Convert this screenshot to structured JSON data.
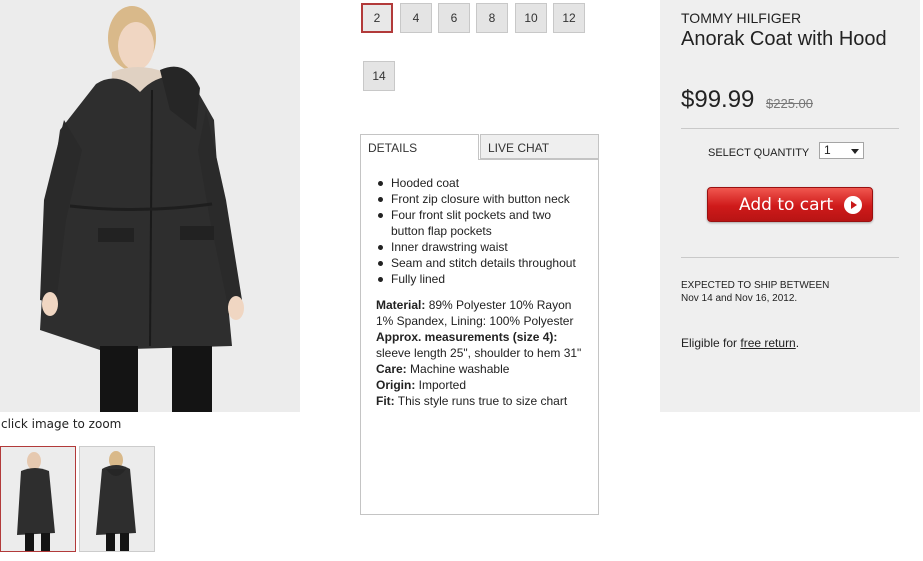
{
  "product": {
    "brand": "TOMMY HILFIGER",
    "name": "Anorak Coat with Hood",
    "price": "$99.99",
    "original_price": "$225.00"
  },
  "gallery": {
    "zoom_hint": "click image to zoom"
  },
  "sizes": {
    "options": [
      "2",
      "4",
      "6",
      "8",
      "10",
      "12",
      "14"
    ],
    "selected": "2"
  },
  "tabs": {
    "details_label": "DETAILS",
    "chat_label": "LIVE CHAT"
  },
  "details": {
    "bullets": [
      "Hooded coat",
      "Front zip closure with button neck",
      "Four front slit pockets and two button flap pockets",
      "Inner drawstring waist",
      "Seam and stitch details throughout",
      "Fully lined"
    ],
    "material_label": "Material:",
    "material_value": " 89% Polyester 10% Rayon 1% Spandex, Lining: 100% Polyester",
    "measure_label": "Approx. measurements (size 4):",
    "measure_value": " sleeve length 25\", shoulder to hem 31\"",
    "care_label": "Care:",
    "care_value": " Machine washable",
    "origin_label": "Origin:",
    "origin_value": " Imported",
    "fit_label": "Fit:",
    "fit_value": " This style runs true to size chart"
  },
  "purchase": {
    "qty_label": "SELECT QUANTITY",
    "qty_value": "1",
    "add_to_cart": "Add to cart",
    "ship_line1": "EXPECTED TO SHIP BETWEEN",
    "ship_line2": "Nov 14 and Nov 16, 2012.",
    "eligible_prefix": "Eligible for ",
    "free_return": "free return",
    "eligible_suffix": "."
  },
  "colors": {
    "accent": "#cf1a1a",
    "panel_bg": "#efefef",
    "selected_border": "#b23a3a"
  }
}
